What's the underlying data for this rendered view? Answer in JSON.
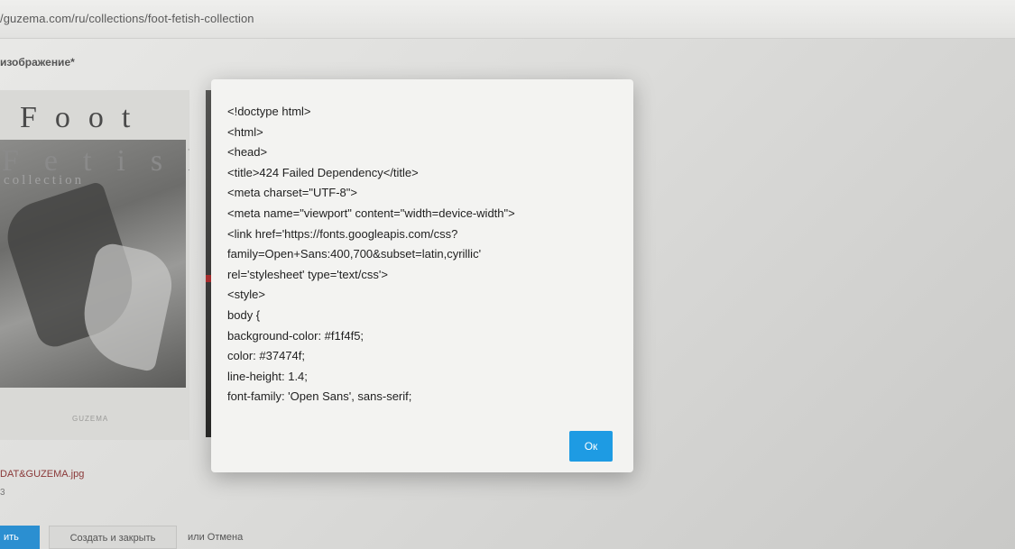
{
  "browser": {
    "url": "/guzema.com/ru/collections/foot-fetish-collection"
  },
  "page": {
    "heading": "изображение*",
    "preview": {
      "word1": "Foot",
      "word2": "Fetish",
      "word3": "collection",
      "logo": "GUZEMA"
    },
    "file_name": "DAT&GUZEMA.jpg",
    "file_sub": "3",
    "buttons": {
      "primary_partial": "ить",
      "create_close": "Создать и закрыть",
      "or_cancel": "или Отмена"
    }
  },
  "modal": {
    "lines": [
      "<!doctype html>",
      "<html>",
      "<head>",
      "<title>424 Failed Dependency</title>",
      "<meta charset=\"UTF-8\">",
      "<meta name=\"viewport\" content=\"width=device-width\">",
      "<link href='https://fonts.googleapis.com/css?",
      "family=Open+Sans:400,700&subset=latin,cyrillic'",
      "rel='stylesheet' type='text/css'>",
      "<style>",
      "body {",
      "background-color: #f1f4f5;",
      "color: #37474f;",
      "line-height: 1.4;",
      "font-family: 'Open Sans', sans-serif;"
    ],
    "ok_label": "Ок"
  },
  "colors": {
    "accent": "#1e9be3",
    "modal_bg": "#f3f3f1"
  }
}
